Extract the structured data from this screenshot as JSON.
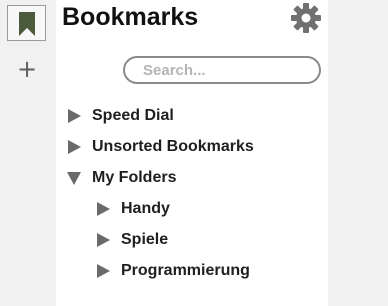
{
  "header": {
    "title": "Bookmarks",
    "settings_icon": "gear-icon",
    "bookmark_tab_icon": "bookmark-icon",
    "add_label": "+"
  },
  "search": {
    "placeholder": "Search...",
    "value": ""
  },
  "tree": {
    "items": [
      {
        "label": "Speed Dial",
        "expanded": false
      },
      {
        "label": "Unsorted Bookmarks",
        "expanded": false
      },
      {
        "label": "My Folders",
        "expanded": true,
        "children": [
          {
            "label": "Handy",
            "expanded": false
          },
          {
            "label": "Spiele",
            "expanded": false
          },
          {
            "label": "Programmierung",
            "expanded": false
          }
        ]
      }
    ]
  },
  "colors": {
    "rail_background": "#f1f1f1",
    "bookmark_icon": "#4a5a3a",
    "arrow": "#6a6a6a",
    "text": "#1f1f1f"
  }
}
